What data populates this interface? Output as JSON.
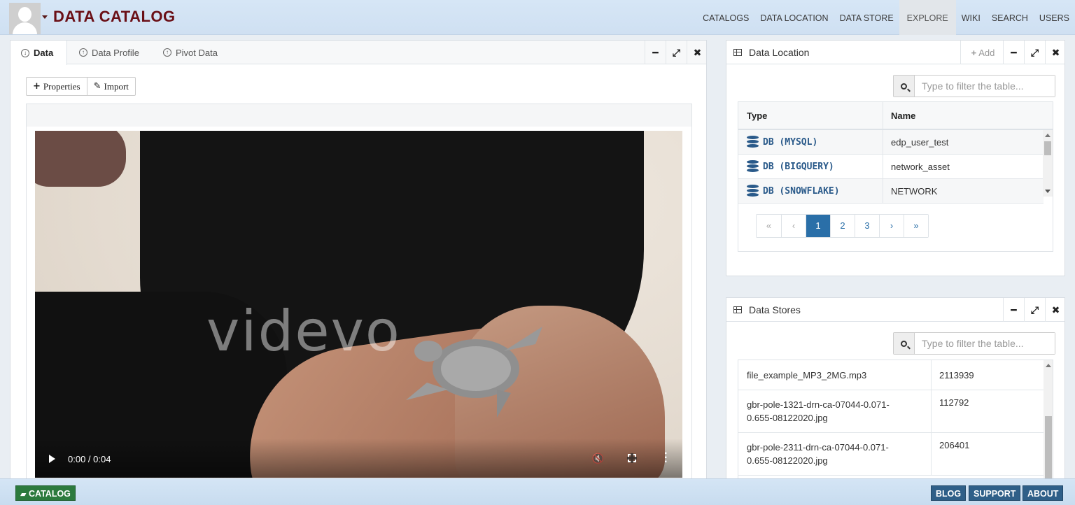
{
  "header": {
    "brand": "DATA CATALOG",
    "nav": [
      "CATALOGS",
      "DATA LOCATION",
      "DATA STORE",
      "EXPLORE",
      "WIKI",
      "SEARCH",
      "USERS"
    ],
    "active_nav": "EXPLORE"
  },
  "data_panel": {
    "tabs": [
      "Data",
      "Data Profile",
      "Pivot Data"
    ],
    "active_tab": "Data",
    "buttons": {
      "properties": "Properties",
      "import": "Import"
    },
    "video": {
      "time": "0:00 / 0:04",
      "watermark": "videvo"
    }
  },
  "data_location": {
    "title": "Data Location",
    "add_label": "Add",
    "search_placeholder": "Type to filter the table...",
    "columns": [
      "Type",
      "Name"
    ],
    "rows": [
      {
        "type": "DB (MYSQL)",
        "name": "edp_user_test"
      },
      {
        "type": "DB (BIGQUERY)",
        "name": "network_asset"
      },
      {
        "type": "DB (SNOWFLAKE)",
        "name": "NETWORK"
      }
    ],
    "pagination": {
      "pages": [
        "1",
        "2",
        "3"
      ],
      "current": "1",
      "first": "«",
      "prev": "‹",
      "next": "›",
      "last": "»"
    }
  },
  "data_stores": {
    "title": "Data Stores",
    "search_placeholder": "Type to filter the table...",
    "rows": [
      {
        "name": "file_example_MP3_2MG.mp3",
        "size": "2113939"
      },
      {
        "name_line1": "gbr-pole-1321-drn-ca-07044-0.071-",
        "name_line2": "0.655-08122020.jpg",
        "size": "112792"
      },
      {
        "name_line1": "gbr-pole-2311-drn-ca-07044-0.071-",
        "name_line2": "0.655-08122020.jpg",
        "size": "206401"
      }
    ]
  },
  "footer": {
    "catalog": "CATALOG",
    "links": [
      "BLOG",
      "SUPPORT",
      "ABOUT"
    ]
  },
  "colors": {
    "brand": "#6a0f16",
    "link_blue": "#2a6fa8",
    "db_blue": "#2a5a8a",
    "catalog_green": "#2c7a3d",
    "footer_button_blue": "#2f5f88"
  }
}
